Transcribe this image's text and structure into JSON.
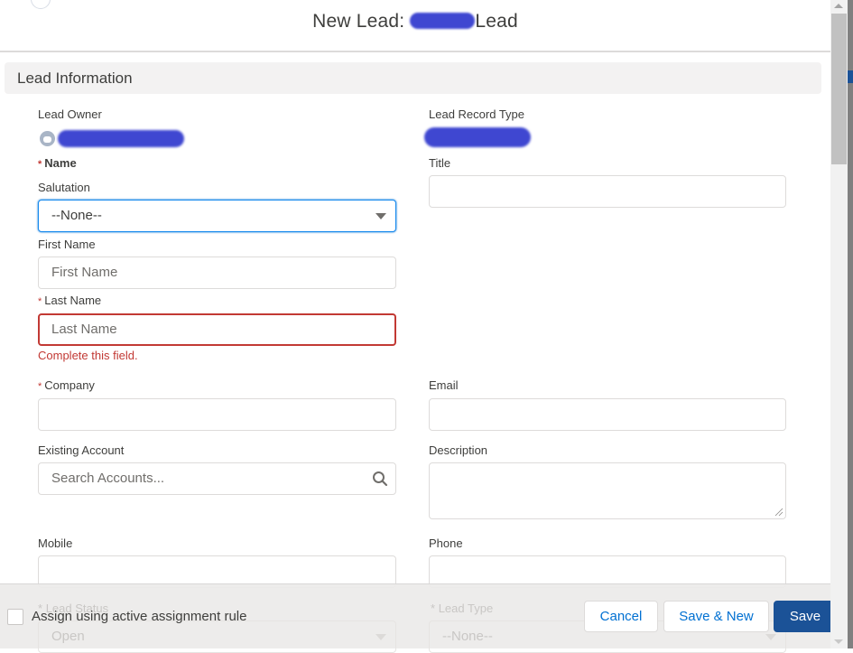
{
  "modal": {
    "title_prefix": "New Lead:",
    "title_suffix": "Lead"
  },
  "section": {
    "title": "Lead Information"
  },
  "fields": {
    "lead_owner": {
      "label": "Lead Owner"
    },
    "lead_record_type": {
      "label": "Lead Record Type"
    },
    "name": {
      "label": "Name",
      "required": true
    },
    "title": {
      "label": "Title",
      "value": ""
    },
    "salutation": {
      "label": "Salutation",
      "value": "--None--"
    },
    "first_name": {
      "label": "First Name",
      "placeholder": "First Name",
      "value": ""
    },
    "last_name": {
      "label": "Last Name",
      "placeholder": "Last Name",
      "value": "",
      "required": true,
      "error": "Complete this field."
    },
    "company": {
      "label": "Company",
      "value": "",
      "required": true
    },
    "email": {
      "label": "Email",
      "value": ""
    },
    "existing_account": {
      "label": "Existing Account",
      "placeholder": "Search Accounts..."
    },
    "description": {
      "label": "Description",
      "value": ""
    },
    "mobile": {
      "label": "Mobile",
      "value": ""
    },
    "phone": {
      "label": "Phone",
      "value": ""
    },
    "lead_status": {
      "label": "Lead Status",
      "value": "Open",
      "required": true
    },
    "lead_type": {
      "label": "Lead Type",
      "value": "--None--",
      "required": true
    }
  },
  "required_marker": "*",
  "footer": {
    "assign_rule_label": "Assign using active assignment rule",
    "assign_rule_checked": false,
    "cancel_label": "Cancel",
    "save_new_label": "Save & New",
    "save_label": "Save"
  },
  "colors": {
    "brand": "#1b5297",
    "error": "#c23934",
    "focus": "#1589ee"
  }
}
